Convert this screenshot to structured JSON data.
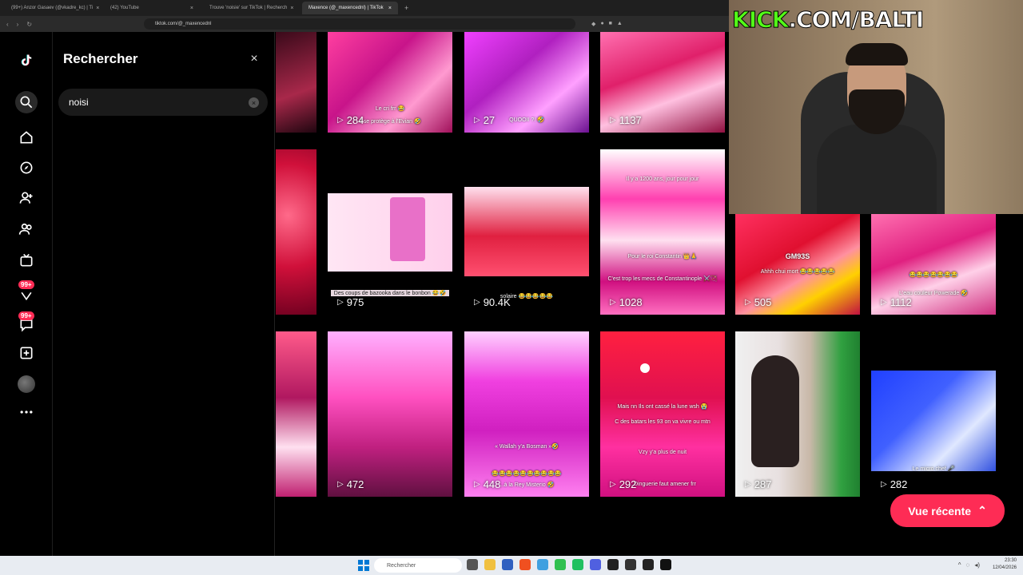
{
  "browser": {
    "tabs": [
      {
        "label": "(99+) Anzor Gasaev (@vkadre_kc) | Ti",
        "active": false
      },
      {
        "label": "(42) YouTube",
        "active": false
      },
      {
        "label": "Trouve 'noisie' sur TikTok | Recherch",
        "active": false
      },
      {
        "label": "Maxence (@_maxencednl) | TikTok",
        "active": true
      }
    ],
    "new_tab": "+",
    "url": "tiktok.com/@_maxencednl"
  },
  "rail": {
    "badge_1": "99+",
    "badge_2": "99+"
  },
  "search": {
    "title": "Rechercher",
    "query": "noisi",
    "close": "×",
    "clear": "×"
  },
  "content": {
    "heading_partial": "nte",
    "videos": [
      {
        "views": "284",
        "caption": "Le cri frr 😂",
        "caption2": "Il se protège à l'Evian 🤣"
      },
      {
        "views": "27",
        "caption": "QUOOII ?! 🤣"
      },
      {
        "views": "1137",
        "caption": ""
      },
      {
        "views": "975",
        "caption": "Des coups de bazooka dans le bonbon 😂🤣"
      },
      {
        "views": "90.4K",
        "caption": "solaire 😂😂😂😂😂"
      },
      {
        "views": "1028",
        "caption": "Il y a 1200 ans, jour pour jour",
        "caption2": "Pour le roi Constantin 👑🙏",
        "caption3": "C'est trop les mecs de Constantinople ⚔️🏹"
      },
      {
        "views": "505",
        "caption": "GM93S",
        "caption2": "Ahhh chui mort 😂😂😂😂😂"
      },
      {
        "views": "1112",
        "caption": "😂😂😂😂😂😂😂",
        "caption2": "L'eau couleur Powerade 🤣"
      },
      {
        "views": "472",
        "caption": ""
      },
      {
        "views": "448",
        "caption": "« Wallah y'a Bosman »🤣",
        "caption2": "😂😂😂😂😂😂😂😂😂😂",
        "caption3": "...à la Rey Misterio 🤣"
      },
      {
        "views": "292",
        "caption": "Mais nn Ils ont cassé la lune wsh 😭",
        "caption2": "C des batars les 93 on va vivre ou mtn",
        "caption3": "Vzy y'a plus de nuit",
        "caption4": "...Dinguerie faut amener frr"
      },
      {
        "views": "287",
        "caption": ""
      },
      {
        "views": "282",
        "caption": "Le micro chef 🎤"
      }
    ],
    "vue_recente": "Vue récente"
  },
  "overlay": {
    "kick_brand": "KICK",
    "kick_path": ".COM/BALTI"
  },
  "taskbar": {
    "search_label": "Rechercher",
    "time": "23:30",
    "date": "12/04/2026"
  },
  "colors": {
    "accent": "#fe2c55",
    "kick_green": "#53fc18"
  }
}
